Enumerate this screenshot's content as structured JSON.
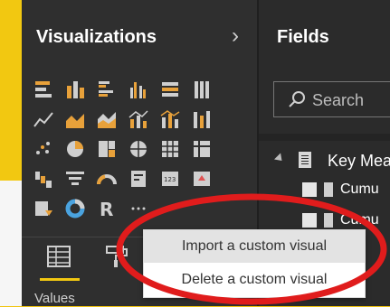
{
  "visualizations": {
    "title": "Visualizations",
    "chevron": "›",
    "icons": [
      "stacked-bar-icon",
      "stacked-column-icon",
      "clustered-bar-icon",
      "clustered-column-icon",
      "100-bar-icon",
      "100-column-icon",
      "line-chart-icon",
      "area-chart-icon",
      "stacked-area-icon",
      "line-column-icon",
      "line-stacked-column-icon",
      "ribbon-chart-icon",
      "scatter-icon",
      "pie-icon",
      "treemap-icon",
      "globe-map-icon",
      "filled-map-icon",
      "matrix-icon",
      "waterfall-icon",
      "funnel-icon",
      "gauge-icon",
      "card-icon",
      "multi-row-card-icon",
      "kpi-icon",
      "slicer-icon",
      "donut-icon",
      "r-visual-icon",
      "more-icon"
    ],
    "tabs": {
      "fields_tab": "fields-well-tab",
      "format_tab": "format-paintroller-tab"
    },
    "values_label": "Values"
  },
  "fields": {
    "title": "Fields",
    "search_label": "Search",
    "items": {
      "table_name": "Key Mea",
      "field1": "Cumu",
      "field2": "Cumu"
    }
  },
  "context_menu": {
    "import_label": "Import a custom visual",
    "delete_label": "Delete a custom visual"
  },
  "colors": {
    "panel_bg": "#2f2f2f",
    "accent_yellow": "#f2c811",
    "annotation_red": "#e01c1c"
  }
}
